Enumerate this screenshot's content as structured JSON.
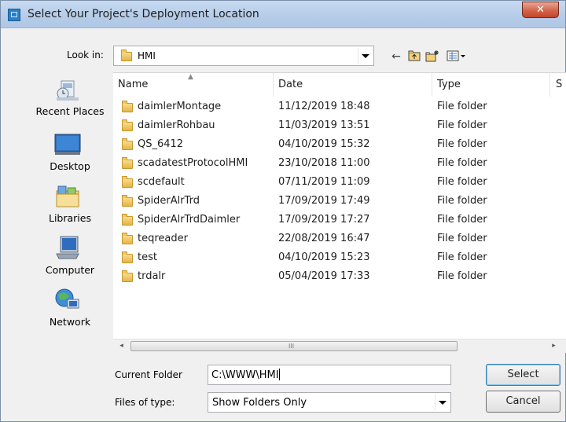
{
  "window": {
    "title": "Select Your Project's Deployment Location",
    "close_label": "✕"
  },
  "lookin": {
    "label": "Look in:",
    "value": "HMI"
  },
  "toolbar": {
    "icons": [
      "back-arrow-icon",
      "up-folder-icon",
      "new-folder-icon",
      "view-menu-icon"
    ]
  },
  "places": [
    {
      "label": "Recent Places",
      "icon": "recent-places-icon"
    },
    {
      "label": "Desktop",
      "icon": "desktop-icon"
    },
    {
      "label": "Libraries",
      "icon": "libraries-icon"
    },
    {
      "label": "Computer",
      "icon": "computer-icon"
    },
    {
      "label": "Network",
      "icon": "network-icon"
    }
  ],
  "columns": {
    "name": "Name",
    "date": "Date",
    "type": "Type",
    "size": "S"
  },
  "files": [
    {
      "name": "daimlerMontage",
      "date": "11/12/2019 18:48",
      "type": "File folder"
    },
    {
      "name": "daimlerRohbau",
      "date": "11/03/2019 13:51",
      "type": "File folder"
    },
    {
      "name": "QS_6412",
      "date": "04/10/2019 15:32",
      "type": "File folder"
    },
    {
      "name": "scadatestProtocolHMI",
      "date": "23/10/2018 11:00",
      "type": "File folder"
    },
    {
      "name": "scdefault",
      "date": "07/11/2019 11:09",
      "type": "File folder"
    },
    {
      "name": "SpiderAlrTrd",
      "date": "17/09/2019 17:49",
      "type": "File folder"
    },
    {
      "name": "SpiderAlrTrdDaimler",
      "date": "17/09/2019 17:27",
      "type": "File folder"
    },
    {
      "name": "teqreader",
      "date": "22/08/2019 16:47",
      "type": "File folder"
    },
    {
      "name": "test",
      "date": "04/10/2019 15:23",
      "type": "File folder"
    },
    {
      "name": "trdalr",
      "date": "05/04/2019 17:33",
      "type": "File folder"
    }
  ],
  "scrollbar": {
    "left": "◂",
    "right": "▸",
    "grip": "III"
  },
  "form": {
    "current_folder_label": "Current Folder",
    "current_folder_value": "C:\\WWW\\HMI",
    "files_of_type_label": "Files of type:",
    "files_of_type_value": "Show Folders Only"
  },
  "buttons": {
    "select": "Select",
    "cancel": "Cancel"
  }
}
